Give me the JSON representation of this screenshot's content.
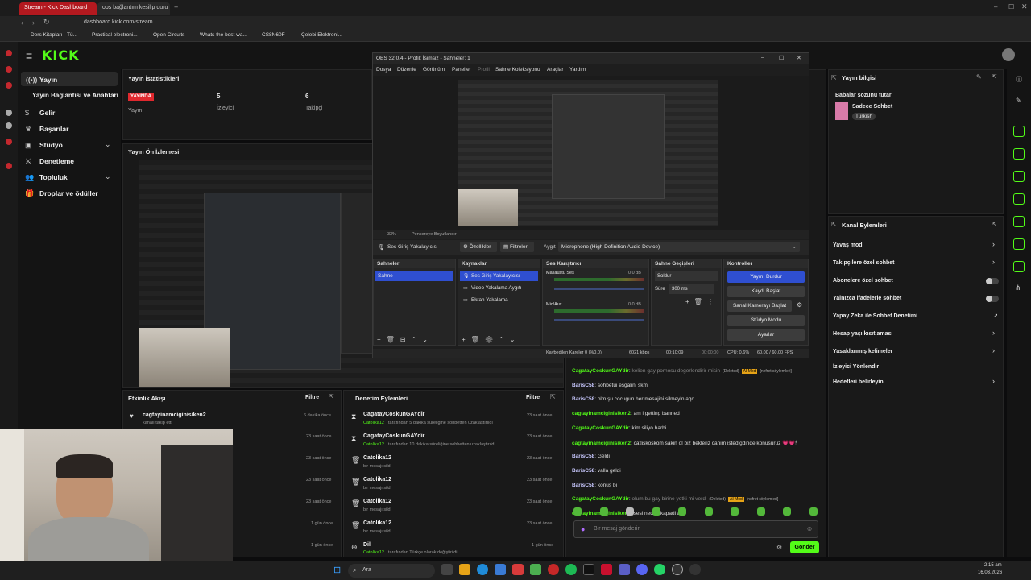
{
  "browser": {
    "tabs": [
      "Stream - Kick Dashboard",
      "obs bağlantım kesilip duru"
    ],
    "url": "dashboard.kick.com/stream",
    "bookmarks": [
      "Ders Kitapları - Tü...",
      "Practical electroni...",
      "Open Circuits",
      "Whats the best wa...",
      "CS8N60F",
      "Çelebi Elektroni..."
    ]
  },
  "kick": {
    "logo": "KICK",
    "nav": [
      "Yayın",
      "Yayın Bağlantısı ve Anahtarı",
      "Gelir",
      "Başarılar",
      "Stüdyo",
      "Denetleme",
      "Topluluk",
      "Droplar ve ödüller"
    ],
    "stats": {
      "title": "Yayın İstatistikleri",
      "badge": "YAYINDA",
      "status_label": "Yayın",
      "viewers": "5",
      "viewers_label": "İzleyici",
      "followers": "6",
      "followers_label": "Takipçi"
    },
    "preview_title": "Yayın Ön İzlemesi",
    "activity": {
      "title": "Etkinlik Akışı",
      "filter": "Filtre",
      "rows": [
        {
          "name": "cagtayinamciginisiken2",
          "sub": "kanalı takip etti",
          "time": "6 dakika önce"
        },
        {
          "name": "",
          "sub": "",
          "time": "23 saat önce"
        },
        {
          "name": "",
          "sub": "",
          "time": "23 saat önce"
        },
        {
          "name": "",
          "sub": "",
          "time": "23 saat önce"
        },
        {
          "name": "",
          "sub": "",
          "time": "23 saat önce"
        },
        {
          "name": "",
          "sub": "",
          "time": "1 gün önce"
        },
        {
          "name": "",
          "sub": "",
          "time": "1 gün önce"
        }
      ]
    },
    "moderation": {
      "title": "Denetim Eylemleri",
      "filter": "Filtre",
      "rows": [
        {
          "name": "CagatayCoskunGAYdir",
          "sub1": "Catolika12",
          "sub2": "tarafından 5 dakika süreliğine sohbetten uzaklaştırıldı",
          "time": "23 saat önce"
        },
        {
          "name": "CagatayCoskunGAYdir",
          "sub1": "Catolika12",
          "sub2": "tarafından 10 dakika süreliğine sohbetten uzaklaştırıldı",
          "time": "23 saat önce"
        },
        {
          "name": "Catolika12",
          "sub1": "",
          "sub2": "bir mesajı sildi",
          "time": "23 saat önce"
        },
        {
          "name": "Catolika12",
          "sub1": "",
          "sub2": "bir mesajı sildi",
          "time": "23 saat önce"
        },
        {
          "name": "Catolika12",
          "sub1": "",
          "sub2": "bir mesajı sildi",
          "time": "23 saat önce"
        },
        {
          "name": "Catolika12",
          "sub1": "",
          "sub2": "bir mesajı sildi",
          "time": "23 saat önce"
        },
        {
          "name": "Dil",
          "sub1": "Catolika12",
          "sub2": "tarafından Türkçe olarak değiştirildi",
          "time": "1 gün önce"
        }
      ]
    },
    "chat": {
      "lines": [
        {
          "user": "CagatayCoskunGAYdir",
          "msg": "kelien gay pornosu degerlendirir misin",
          "tag": "(Deleted)",
          "tag2": "AI Mod",
          "tag3": "[nefret söylemleri]"
        },
        {
          "user": "BarisC58",
          "msg": "sohbetui esgalini skm"
        },
        {
          "user": "BarisC58",
          "msg": "olm şu cocugun her mesajini silmeyin aqq"
        },
        {
          "user": "cagtayinamciginisiken2",
          "msg": "am i getting banned"
        },
        {
          "user": "CagatayCoskunGAYdir",
          "msg": "kim siliyo harbi"
        },
        {
          "user": "cagtayinamciginisiken2",
          "msg": "catliskoskom sakin ol biz bekleriz canim istedigdinde konusuruz 💗💗🕯"
        },
        {
          "user": "BarisC58",
          "msg": "Geldi"
        },
        {
          "user": "BarisC58",
          "msg": "valla geldi"
        },
        {
          "user": "BarisC58",
          "msg": "konus bi"
        },
        {
          "user": "CagatayCoskunGAYdir",
          "msg": "olum bu gay birine yetki mi verdi",
          "tag": "(Deleted)",
          "tag2": "AI Mod",
          "tag3": "[nefret söylemleri]"
        },
        {
          "user": "cagtayinamciginisiken2",
          "msg": "sesi neden kapadi aq"
        }
      ],
      "placeholder": "Bir mesaj gönderin",
      "send": "Gönder"
    },
    "info": {
      "title": "Yayın bilgisi",
      "stream_title": "Babalar sözünü tutar",
      "category": "Sadece Sohbet",
      "tag": "Turkish"
    },
    "channel_actions": {
      "title": "Kanal Eylemleri",
      "items": [
        "Yavaş mod",
        "Takipçilere özel sohbet",
        "Abonelere özel sohbet",
        "Yalnızca ifadelerle sohbet",
        "Yapay Zeka ile Sohbet Denetimi",
        "Hesap yaşı kısıtlaması",
        "Yasaklanmış kelimeler",
        "İzleyici Yönlendir",
        "Hedefleri belirleyin"
      ]
    }
  },
  "obs": {
    "title": "OBS 32.0.4 - Profil: İsimsiz - Sahneler: 1",
    "menu": [
      "Dosya",
      "Düzenle",
      "Görünüm",
      "Paneller",
      "Profil",
      "Sahne Koleksiyonu",
      "Araçlar",
      "Yardım"
    ],
    "zoom": "33%",
    "fit": "Pencereye Boyutlandır",
    "source_bar": {
      "source": "Ses Giriş Yakalayıcısı",
      "props": "Özellikler",
      "filters": "Filtreler",
      "device_label": "Aygıt",
      "device": "Microphone (High Definition Audio Device)"
    },
    "docks": {
      "scenes": "Sahneler",
      "sources": "Kaynaklar",
      "mixer": "Ses Karıştırıcı",
      "transitions": "Sahne Geçişleri",
      "controls": "Kontroller"
    },
    "scene": "Sahne",
    "sources": [
      "Ses Giriş Yakalayıcısı",
      "Video Yakalama Aygıtı",
      "Ekran Yakalama"
    ],
    "mixer": [
      {
        "name": "Masaüstü Ses",
        "db": "0.0 dB"
      },
      {
        "name": "Mic/Aux",
        "db": "0.0 dB"
      }
    ],
    "transition": "Soldur",
    "duration_label": "Süre",
    "duration": "300 ms",
    "controls": [
      "Yayını Durdur",
      "Kaydı Başlat",
      "Sanal Kamerayı Başlat",
      "Stüdyo Modu",
      "Ayarlar"
    ],
    "status": {
      "dropped": "Kaybedilen Kareler 0 (%0.0)",
      "kbps": "6021 kbps",
      "live": "00:10:09",
      "rec": "00:00:00",
      "cpu": "CPU: 0.6%",
      "fps": "60.00 / 60.00 FPS"
    }
  },
  "taskbar": {
    "search": "Ara",
    "time": "2:15 am",
    "date": "16.03.2026"
  },
  "colors": {
    "kick_green": "#53fc18",
    "live_red": "#e0282e",
    "obs_blue": "#2f4fd0"
  }
}
